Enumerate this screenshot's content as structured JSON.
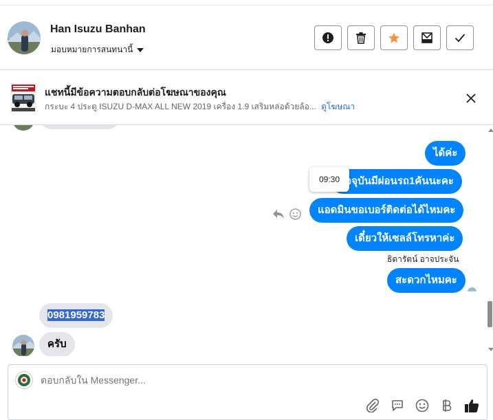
{
  "header": {
    "contact_name": "Han Isuzu Banhan",
    "assign_label": "มอบหมายการสนทนานี้",
    "buttons": [
      "report-icon",
      "trash-icon",
      "star-icon",
      "archive-icon",
      "check-icon"
    ]
  },
  "ad": {
    "title": "แชทนี้มีข้อความตอบกลับต่อโฆษณาของคุณ",
    "subtitle": "กระบะ 4 ประตู ISUZU D-MAX ALL NEW 2019 เครื่อง 1.9 เสริมหล่อด้วยล้อ...",
    "link": "ดูโฆษณา"
  },
  "messages": {
    "out_1": "ได้ค่ะ",
    "out_2": "ปัจจุบันมีผ่อนรถ1คันนะคะ",
    "out_3": "แอดมินขอเบอร์ติดต่อได้ไหมคะ",
    "out_4": "เดี๋ยวให้เซลล์โทรหาค่ะ",
    "sender": "ธิดารัตน์ อาจประจัน",
    "out_5": "สะดวกไหมคะ",
    "in_1": "0981959783",
    "in_2": "ครับ"
  },
  "tooltip_time": "09:30",
  "composer": {
    "placeholder": "ตอบกลับใน Messenger..."
  },
  "colors": {
    "accent": "#0084ff",
    "star": "#f7923b",
    "link": "#216fdb",
    "bubble_in": "#e4e6eb"
  }
}
